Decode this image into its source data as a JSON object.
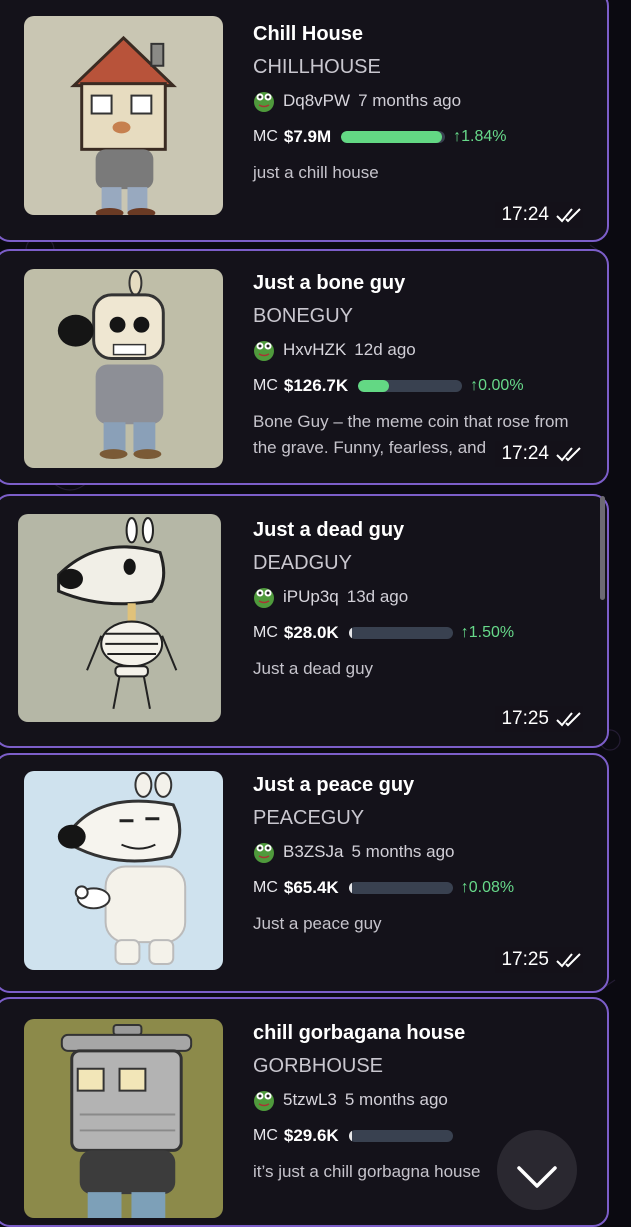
{
  "cards": [
    {
      "title": "Chill House",
      "ticker": "CHILLHOUSE",
      "creator": "Dq8vPW",
      "age": "7 months ago",
      "mc_label": "MC",
      "mc_value": "$7.9M",
      "progress": 0.97,
      "change": "↑1.84%",
      "description": "just a chill house",
      "time": "17:24",
      "image_icon": "house-head-character-icon"
    },
    {
      "title": "Just a bone guy",
      "ticker": "BONEGUY",
      "creator": "HxvHZK",
      "age": "12d ago",
      "mc_label": "MC",
      "mc_value": "$126.7K",
      "progress": 0.3,
      "change": "↑0.00%",
      "description": "Bone Guy – the meme coin that rose from the grave. Funny, fearless, and",
      "time": "17:24",
      "image_icon": "skull-guy-character-icon"
    },
    {
      "title": "Just a dead guy",
      "ticker": "DEADGUY",
      "creator": "iPUp3q",
      "age": "13d ago",
      "mc_label": "MC",
      "mc_value": "$28.0K",
      "progress": 0.02,
      "change": "↑1.50%",
      "description": "Just a dead guy",
      "time": "17:25",
      "image_icon": "skeleton-dog-character-icon"
    },
    {
      "title": "Just a peace guy",
      "ticker": "PEACEGUY",
      "creator": "B3ZSJa",
      "age": "5 months ago",
      "mc_label": "MC",
      "mc_value": "$65.4K",
      "progress": 0.02,
      "change": "↑0.08%",
      "description": "Just a peace guy",
      "time": "17:25",
      "image_icon": "white-dog-with-dove-icon"
    },
    {
      "title": "chill gorbagana house",
      "ticker": "GORBHOUSE",
      "creator": "5tzwL3",
      "age": "5 months ago",
      "mc_label": "MC",
      "mc_value": "$29.6K",
      "progress": 0.02,
      "change": "",
      "description": "it’s just a chill gorbagna house",
      "time": "",
      "image_icon": "trash-can-head-character-icon"
    }
  ],
  "colors": {
    "background": "#0b0a11",
    "card": "#14121a",
    "card_border": "#7c5ec9",
    "progress_fill": "#63d884",
    "progress_track": "#394150",
    "positive_change": "#67d98a"
  },
  "scroll_button_icon": "chevron-down-icon"
}
